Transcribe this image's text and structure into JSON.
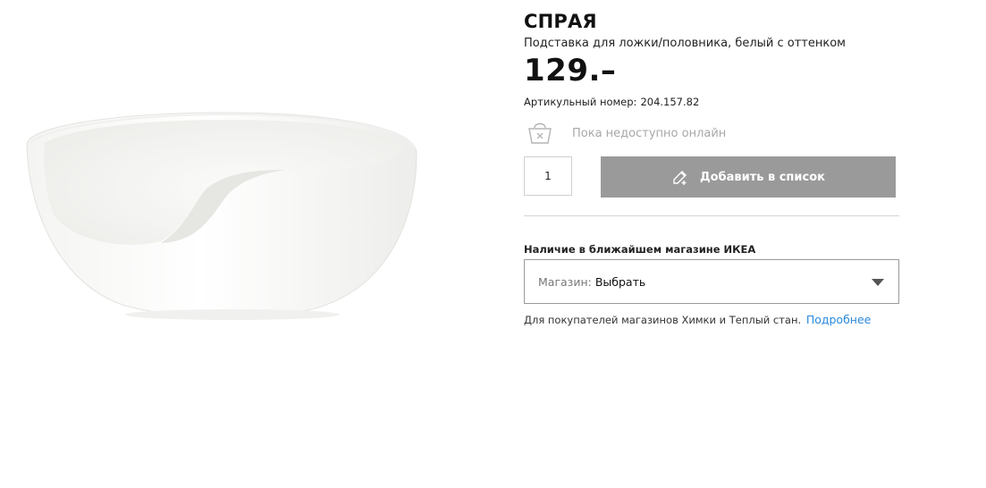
{
  "product": {
    "name": "СПРАЯ",
    "description": "Подставка для ложки/половника, белый с оттенком",
    "price": "129.–",
    "article_label": "Артикульный номер:",
    "article_number": "204.157.82",
    "image_icon": "spoon-rest-bowl-image"
  },
  "availability": {
    "icon": "basket-icon",
    "online_status": "Пока недоступно онлайн"
  },
  "purchase": {
    "quantity": "1",
    "add_list_label": "Добавить в список",
    "add_list_icon": "pencil-icon"
  },
  "store": {
    "heading": "Наличие в ближайшем магазине ИКЕА",
    "select_label": "Магазин:",
    "select_value": "Выбрать",
    "note": "Для покупателей магазинов Химки и Теплый стан.",
    "more_link": "Подробнее",
    "link_color": "#2a8adb"
  },
  "colors": {
    "button_bg": "#9a9a9a",
    "muted_text": "#a8a8a8"
  }
}
